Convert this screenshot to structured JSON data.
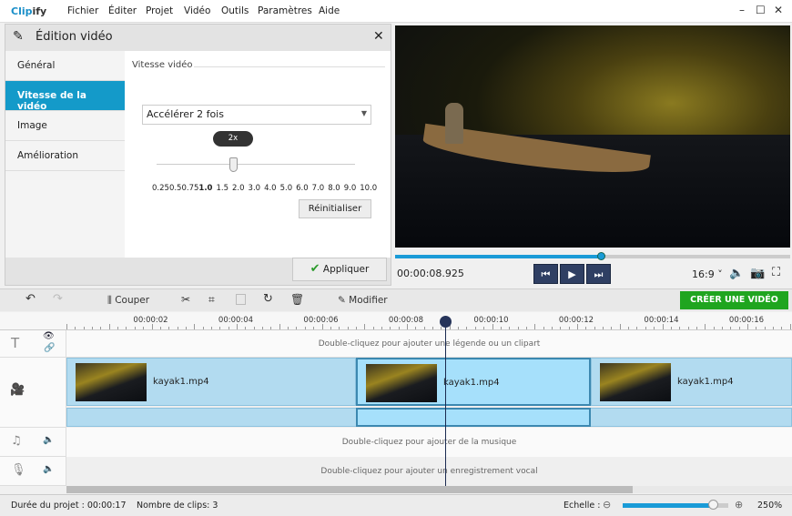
{
  "app": {
    "logo": "Clipify",
    "menu": [
      "Fichier",
      "Éditer",
      "Projet",
      "Vidéo",
      "Outils",
      "Paramètres",
      "Aide"
    ]
  },
  "edit_panel": {
    "title": "Édition vidéo",
    "tabs": [
      "Général",
      "Vitesse de la vidéo",
      "Image",
      "Amélioration"
    ],
    "active_tab": 1,
    "section_label": "Vitesse vidéo",
    "speed_select": "Accélérer 2 fois",
    "slider_tooltip": "2x",
    "speed_ticks": [
      "0.25",
      "0.5",
      "0.75",
      "1.0",
      "1.5",
      "2.0",
      "3.0",
      "4.0",
      "5.0",
      "6.0",
      "7.0",
      "8.0",
      "9.0",
      "10.0"
    ],
    "selected_speed": "2.0",
    "reset_label": "Réinitialiser",
    "apply_label": "Appliquer"
  },
  "player": {
    "time": "00:00:08.925",
    "progress": 0.52,
    "aspect": "16:9"
  },
  "toolbar": {
    "cut_label": "Couper",
    "edit_label": "Modifier",
    "create_label": "CRÉER UNE VIDÉO",
    "create_color": "#1fa51f"
  },
  "timeline": {
    "ticks": [
      "00:00:02",
      "00:00:04",
      "00:00:06",
      "00:00:08",
      "00:00:10",
      "00:00:12",
      "00:00:14",
      "00:00:16"
    ],
    "playhead": "00:00:08.925",
    "text_hint": "Double-cliquez pour ajouter une légende ou un clipart",
    "clips": [
      {
        "name": "kayak1.mp4"
      },
      {
        "name": "kayak1.mp4"
      },
      {
        "name": "kayak1.mp4"
      }
    ],
    "music_hint": "Double-cliquez pour ajouter de la musique",
    "voice_hint": "Double-cliquez pour ajouter un enregistrement vocal"
  },
  "status": {
    "duration_label": "Durée du projet :",
    "duration": "00:00:17",
    "clips_label": "Nombre de clips: 3",
    "scale_label": "Echelle :",
    "zoom": "250%",
    "zoom_level": 0.85
  }
}
